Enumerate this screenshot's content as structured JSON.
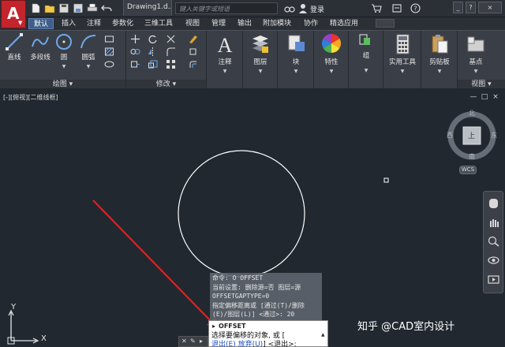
{
  "titlebar": {
    "app_letter": "A",
    "document_title": "Drawing1.d...",
    "search_placeholder": "键入关键字或短语",
    "login_label": "登录",
    "win_minimize": "_",
    "win_help": "?",
    "win_close": "×"
  },
  "tabs": [
    "默认",
    "插入",
    "注释",
    "参数化",
    "三维工具",
    "视图",
    "管理",
    "输出",
    "附加模块",
    "协作",
    "精选应用"
  ],
  "ribbon": {
    "draw_panel": {
      "label": "绘图 ▾",
      "tools": [
        "直线",
        "多段线",
        "圆",
        "圆弧"
      ]
    },
    "modify_panel": {
      "label": "修改 ▾"
    },
    "annotation": {
      "label": "注释"
    },
    "layers": {
      "label": "图层"
    },
    "block": {
      "label": "块"
    },
    "properties": {
      "label": "特性"
    },
    "group": {
      "label": "组"
    },
    "utilities": {
      "label": "实用工具"
    },
    "clipboard": {
      "label": "剪贴板"
    },
    "base": {
      "label": "基点"
    },
    "view_panel": {
      "label": "视图 ▾"
    }
  },
  "viewport": {
    "label": "[-][俯视][二维线框]",
    "controls": [
      "—",
      "□",
      "×"
    ]
  },
  "viewcube": {
    "north": "北",
    "south": "南",
    "east": "东",
    "west": "西",
    "face": "上",
    "wcs": "WCS"
  },
  "ucs": {
    "x": "X",
    "y": "Y"
  },
  "command_history": [
    "命令: O OFFSET",
    "当前设置: 删除源=否  图层=源",
    "OFFSETGAPTYPE=0",
    "指定偏移距离或 [通过(T)/删除",
    "(E)/图层(L)] <通过>:  20"
  ],
  "popup": {
    "command": "OFFSET",
    "line1": "选择要偏移的对象, 或 [",
    "line2_a": "退出(E)",
    "line2_b": " 放弃(U)",
    "line2_c": "] <退出>:"
  },
  "watermark": "知乎 @CAD室内设计",
  "colors": {
    "background": "#212830",
    "ribbon": "#3a3f47",
    "app_button": "#c4242b",
    "circle": "#ffffff",
    "arrow": "#e02020",
    "active_tab": "#3f5f8a"
  }
}
